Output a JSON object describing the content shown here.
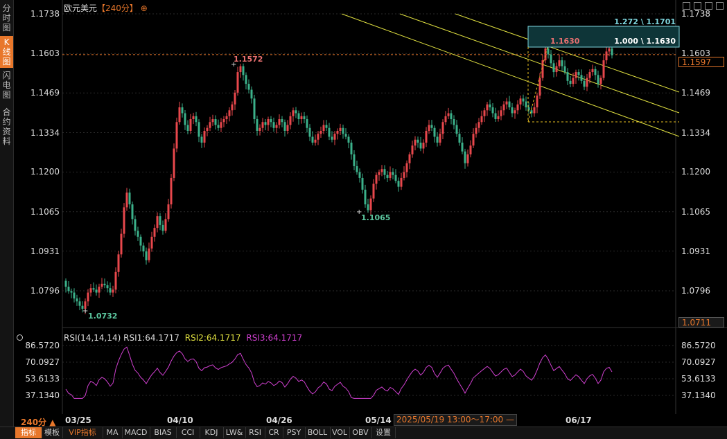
{
  "sidebar": {
    "tabs": [
      {
        "label": "分时图",
        "active": false
      },
      {
        "label": "K线图",
        "active": true
      },
      {
        "label": "闪电图",
        "active": false
      },
      {
        "label": "合约资料",
        "active": false
      }
    ]
  },
  "header": {
    "instrument": "欧元美元",
    "period": "【240分】",
    "period_icon": "add-circle-icon"
  },
  "toolbar_icons": [
    "grid-icon",
    "fullscreen-icon",
    "window-icon",
    "close-icon"
  ],
  "price_axis": {
    "labels": [
      "1.1738",
      "1.1603",
      "1.1469",
      "1.1334",
      "1.1200",
      "1.1065",
      "1.0931",
      "1.0796"
    ],
    "current_price": "1.1597",
    "bottom_value": "1.0711"
  },
  "annotations": {
    "high_label": "1.1572",
    "low_label": "1.1065",
    "start_low_label": "1.0732",
    "recent_high": "1.1630",
    "fib_1272": "1.272 \\ 1.1701",
    "fib_1000": "1.000 \\ 1.1630"
  },
  "rsi": {
    "title": "RSI(14,14,14)",
    "rsi1": "RSI1:64.1717",
    "rsi2": "RSI2:64.1717",
    "rsi3": "RSI3:64.1717",
    "axis": [
      "86.5720",
      "70.0927",
      "53.6133",
      "37.1340"
    ]
  },
  "dates": [
    "03/25",
    "04/10",
    "04/26",
    "05/14",
    "06/17"
  ],
  "crosshair_date": "2025/05/19 13:00～17:00 —",
  "period_selector": "240分 ▲",
  "bottom_tabs": [
    "指标",
    "模板",
    "VIP指标",
    "MA",
    "MACD",
    "BIAS",
    "CCI",
    "KDJ",
    "LW&",
    "RSI",
    "CR",
    "PSY",
    "BOLL",
    "VOL",
    "OBV",
    "设置"
  ],
  "colors": {
    "up": "#e8474c",
    "down": "#3bb18a",
    "accent": "#e8772b",
    "rsi1": "#d040d0",
    "channel": "#e0e040",
    "fib": "#7fd8e0"
  },
  "chart_data": {
    "type": "candlestick",
    "ylim": [
      1.0711,
      1.1738
    ],
    "closes": [
      1.081,
      1.0795,
      1.079,
      1.077,
      1.076,
      1.0745,
      1.0735,
      1.076,
      1.079,
      1.0805,
      1.08,
      1.079,
      1.081,
      1.082,
      1.0815,
      1.0805,
      1.079,
      1.08,
      1.086,
      1.092,
      1.099,
      1.108,
      1.113,
      1.109,
      1.104,
      1.1,
      1.098,
      1.095,
      1.093,
      1.09,
      1.094,
      1.098,
      1.101,
      1.105,
      1.102,
      1.1,
      1.104,
      1.109,
      1.118,
      1.128,
      1.137,
      1.142,
      1.14,
      1.136,
      1.134,
      1.138,
      1.139,
      1.137,
      1.132,
      1.13,
      1.134,
      1.135,
      1.137,
      1.138,
      1.136,
      1.135,
      1.137,
      1.138,
      1.139,
      1.141,
      1.143,
      1.147,
      1.154,
      1.156,
      1.153,
      1.15,
      1.148,
      1.145,
      1.138,
      1.134,
      1.135,
      1.137,
      1.136,
      1.138,
      1.137,
      1.135,
      1.136,
      1.138,
      1.137,
      1.134,
      1.136,
      1.139,
      1.141,
      1.14,
      1.138,
      1.139,
      1.138,
      1.135,
      1.132,
      1.13,
      1.131,
      1.133,
      1.134,
      1.136,
      1.135,
      1.132,
      1.131,
      1.133,
      1.134,
      1.135,
      1.133,
      1.132,
      1.13,
      1.126,
      1.122,
      1.12,
      1.118,
      1.114,
      1.109,
      1.107,
      1.111,
      1.116,
      1.119,
      1.12,
      1.121,
      1.119,
      1.118,
      1.12,
      1.119,
      1.117,
      1.115,
      1.118,
      1.12,
      1.123,
      1.126,
      1.129,
      1.131,
      1.13,
      1.128,
      1.13,
      1.134,
      1.136,
      1.135,
      1.132,
      1.13,
      1.133,
      1.137,
      1.139,
      1.14,
      1.138,
      1.136,
      1.133,
      1.13,
      1.127,
      1.123,
      1.126,
      1.129,
      1.133,
      1.135,
      1.137,
      1.139,
      1.141,
      1.143,
      1.142,
      1.14,
      1.138,
      1.139,
      1.141,
      1.143,
      1.144,
      1.142,
      1.14,
      1.141,
      1.143,
      1.145,
      1.144,
      1.142,
      1.141,
      1.14,
      1.142,
      1.146,
      1.152,
      1.158,
      1.162,
      1.16,
      1.157,
      1.154,
      1.156,
      1.158,
      1.156,
      1.154,
      1.151,
      1.15,
      1.152,
      1.154,
      1.153,
      1.151,
      1.149,
      1.152,
      1.154,
      1.155,
      1.153,
      1.15,
      1.152,
      1.158,
      1.161,
      1.162,
      1.1597
    ]
  }
}
